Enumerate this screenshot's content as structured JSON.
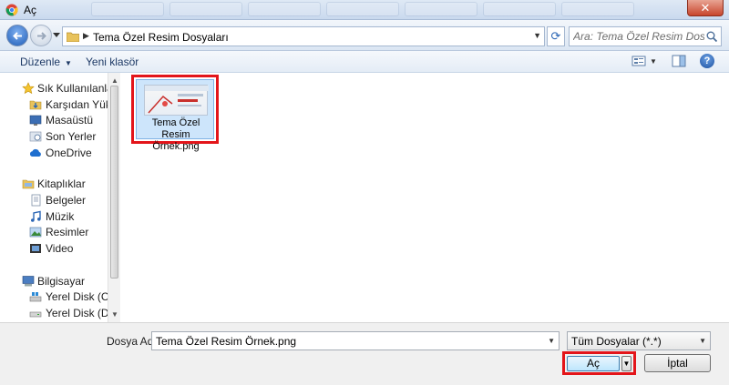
{
  "window": {
    "title": "Aç",
    "close_glyph": "✕"
  },
  "address": {
    "path": "Tema Özel Resim Dosyaları",
    "search_placeholder": "Ara: Tema Özel Resim Dosyaları"
  },
  "toolbar": {
    "organize_label": "Düzenle",
    "new_folder_label": "Yeni klasör"
  },
  "sidebar": {
    "items": [
      {
        "label": "Sık Kullanılanlar",
        "icon": "star-icon"
      },
      {
        "label": "Karşıdan Yüklenenler",
        "icon": "downloads-folder-icon"
      },
      {
        "label": "Masaüstü",
        "icon": "desktop-icon"
      },
      {
        "label": "Son Yerler",
        "icon": "recent-places-icon"
      },
      {
        "label": "OneDrive",
        "icon": "cloud-icon"
      },
      {
        "label": "Kitaplıklar",
        "icon": "libraries-icon"
      },
      {
        "label": "Belgeler",
        "icon": "documents-icon"
      },
      {
        "label": "Müzik",
        "icon": "music-icon"
      },
      {
        "label": "Resimler",
        "icon": "pictures-icon"
      },
      {
        "label": "Video",
        "icon": "video-icon"
      },
      {
        "label": "Bilgisayar",
        "icon": "computer-icon"
      },
      {
        "label": "Yerel Disk (C:)",
        "icon": "local-disk-icon"
      },
      {
        "label": "Yerel Disk (D:)",
        "icon": "drive-icon"
      }
    ]
  },
  "files": [
    {
      "name": "Tema Özel Resim Örnek.png",
      "selected": true
    }
  ],
  "bottom": {
    "filename_label": "Dosya Adı:",
    "filename_value": "Tema Özel Resim Örnek.png",
    "filetype_value": "Tüm Dosyalar (*.*)",
    "open_label": "Aç",
    "cancel_label": "İptal"
  },
  "colors": {
    "highlight": "#e3151a",
    "selection": "#cde5fb"
  }
}
